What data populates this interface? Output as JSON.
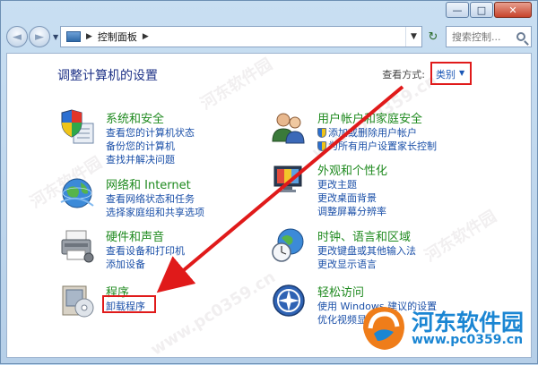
{
  "window": {
    "minimize_glyph": "—",
    "maximize_glyph": "□",
    "close_glyph": "✕"
  },
  "nav": {
    "back_glyph": "◄",
    "forward_glyph": "►",
    "recent_glyph": "▼",
    "refresh_glyph": "↻",
    "breadcrumb_sep": "▶",
    "breadcrumb": "控制面板",
    "breadcrumb_after": "▶",
    "addr_dropdown_glyph": "▼"
  },
  "search": {
    "placeholder": "搜索控制..."
  },
  "main": {
    "heading": "调整计算机的设置",
    "viewby_label": "查看方式:",
    "viewby_value": "类别",
    "viewby_glyph": "▼"
  },
  "categories": {
    "system": {
      "title": "系统和安全",
      "links": [
        "查看您的计算机状态",
        "备份您的计算机",
        "查找并解决问题"
      ],
      "icon": "shield-checklist-icon"
    },
    "network": {
      "title": "网络和 Internet",
      "links": [
        "查看网络状态和任务",
        "选择家庭组和共享选项"
      ],
      "icon": "globe-network-icon"
    },
    "hardware": {
      "title": "硬件和声音",
      "links": [
        "查看设备和打印机",
        "添加设备"
      ],
      "icon": "printer-icon"
    },
    "programs": {
      "title": "程序",
      "links": [
        "卸载程序"
      ],
      "icon": "program-box-icon"
    },
    "users": {
      "title": "用户帐户和家庭安全",
      "links": [
        "添加或删除用户帐户",
        "为所有用户设置家长控制"
      ],
      "icon": "users-icon"
    },
    "appearance": {
      "title": "外观和个性化",
      "links": [
        "更改主题",
        "更改桌面背景",
        "调整屏幕分辨率"
      ],
      "icon": "monitor-paint-icon"
    },
    "clock": {
      "title": "时钟、语言和区域",
      "links": [
        "更改键盘或其他输入法",
        "更改显示语言"
      ],
      "icon": "clock-globe-icon"
    },
    "ease": {
      "title": "轻松访问",
      "links": [
        "使用 Windows 建议的设置",
        "优化视频显示"
      ],
      "icon": "ease-of-access-icon"
    }
  },
  "watermark": {
    "text": "河东软件园",
    "site": "www.pc0359.cn",
    "brand": "河东软件园",
    "url": "www.pc0359.cn"
  },
  "colors": {
    "highlight": "#e01a1a",
    "link": "#1a4fa8",
    "title_green": "#1f8a1f",
    "heading": "#1e3287",
    "brand_blue": "#1b86d3"
  }
}
